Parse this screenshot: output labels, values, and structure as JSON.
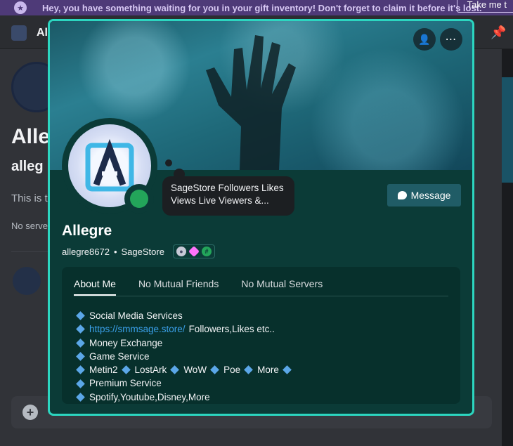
{
  "notice": {
    "text": "Hey, you have something waiting for you in your gift inventory! Don't forget to claim it before it's lost.",
    "button_label": "Take me t"
  },
  "background": {
    "channel_name": "Al",
    "title": "Alle",
    "subtitle": "alleg",
    "description": "This is t",
    "no_servers": "No serve"
  },
  "popup": {
    "custom_status": "SageStore Followers Likes Views Live Viewers &...",
    "message_label": "Message",
    "display_name": "Allegre",
    "username": "allegre8672",
    "separator": "•",
    "server_tag": "SageStore",
    "tabs": [
      {
        "label": "About Me"
      },
      {
        "label": "No Mutual Friends"
      },
      {
        "label": "No Mutual Servers"
      }
    ],
    "about": {
      "line1": "Social Media Services",
      "line2_link": "https://smmsage.store/",
      "line2_rest": "Followers,Likes etc..",
      "line3": "Money Exchange",
      "line4": "Game Service",
      "line5_a": "Metin2",
      "line5_b": "LostArk",
      "line5_c": "WoW",
      "line5_d": "Poe",
      "line5_e": "More",
      "line6": "Premium Service",
      "line7": "Spotify,Youtube,Disney,More"
    }
  },
  "colors": {
    "accent_border": "#2cd6c0",
    "popup_bg": "#0b3b37",
    "online_status": "#23a55a",
    "link": "#3aa0ea",
    "bullet": "#5ba7e8"
  },
  "icons": [
    "gift-icon",
    "server-icon",
    "pin-icon",
    "add-friend-icon",
    "more-icon",
    "chat-icon",
    "status-online-icon",
    "nitro-badge-icon",
    "boost-badge-icon",
    "hash-badge-icon",
    "plus-icon",
    "diamond-icon"
  ]
}
